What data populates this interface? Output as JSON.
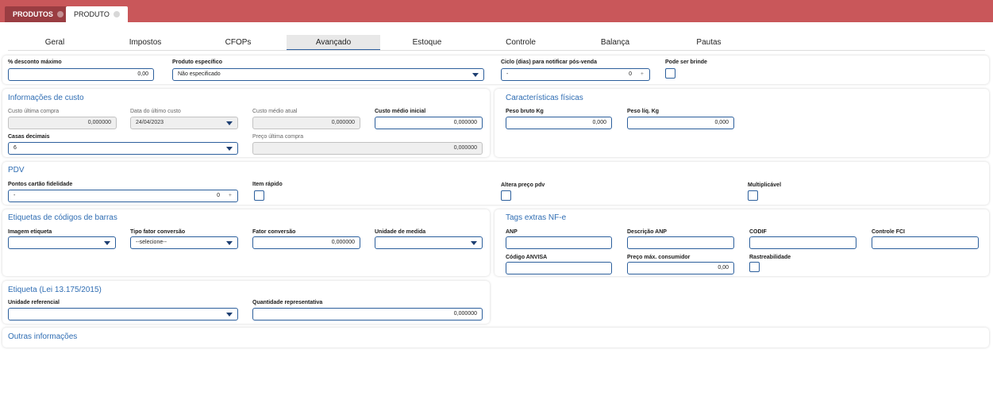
{
  "tabs": {
    "produtos": "PRODUTOS",
    "produto": "PRODUTO"
  },
  "nav": [
    "Geral",
    "Impostos",
    "CFOPs",
    "Avançado",
    "Estoque",
    "Controle",
    "Balança",
    "Pautas"
  ],
  "nav_active": "Avançado",
  "top": {
    "desconto_label": "% desconto máximo",
    "desconto_value": "0,00",
    "produto_especifico_label": "Produto específico",
    "produto_especifico_value": "Não especificado",
    "ciclo_label": "Ciclo (dias) para notificar pós-venda",
    "ciclo_value": "-",
    "ciclo_num": "0",
    "brinde_label": "Pode ser brinde"
  },
  "custo": {
    "title": "Informações de custo",
    "ultima_compra_label": "Custo última compra",
    "ultima_compra_value": "0,000000",
    "data_label": "Data do último custo",
    "data_value": "24/04/2023",
    "medio_atual_label": "Custo médio atual",
    "medio_atual_value": "0,000000",
    "medio_inicial_label": "Custo médio inicial",
    "medio_inicial_value": "0,000000",
    "casas_label": "Casas decimais",
    "casas_value": "6",
    "preco_label": "Preço última compra",
    "preco_value": "0,000000"
  },
  "fisicas": {
    "title": "Características físicas",
    "bruto_label": "Peso bruto Kg",
    "bruto_value": "0,000",
    "liq_label": "Peso líq. Kg",
    "liq_value": "0,000"
  },
  "pdv": {
    "title": "PDV",
    "pontos_label": "Pontos cartão fidelidade",
    "pontos_value": "-",
    "pontos_num": "0",
    "item_rapido_label": "Item rápido",
    "altera_label": "Altera preço pdv",
    "multiplicavel_label": "Multiplicável"
  },
  "etiquetas": {
    "title": "Etiquetas de códigos de barras",
    "imagem_label": "Imagem etiqueta",
    "imagem_value": "",
    "tipo_label": "Tipo fator conversão",
    "tipo_value": "--selecione--",
    "fator_label": "Fator conversão",
    "fator_value": "0,000000",
    "unidade_label": "Unidade de medida",
    "unidade_value": ""
  },
  "tags": {
    "title": "Tags extras NF-e",
    "anp_label": "ANP",
    "descricao_label": "Descrição ANP",
    "codif_label": "CODIF",
    "fci_label": "Controle FCI",
    "anvisa_label": "Código ANVISA",
    "preco_max_label": "Preço máx. consumidor",
    "preco_max_value": "0,00",
    "rastre_label": "Rastreabilidade"
  },
  "lei": {
    "title": "Etiqueta (Lei 13.175/2015)",
    "unidade_label": "Unidade referencial",
    "unidade_value": "",
    "quantidade_label": "Quantidade representativa",
    "quantidade_value": "0,000000"
  },
  "outras": {
    "title": "Outras informações"
  }
}
